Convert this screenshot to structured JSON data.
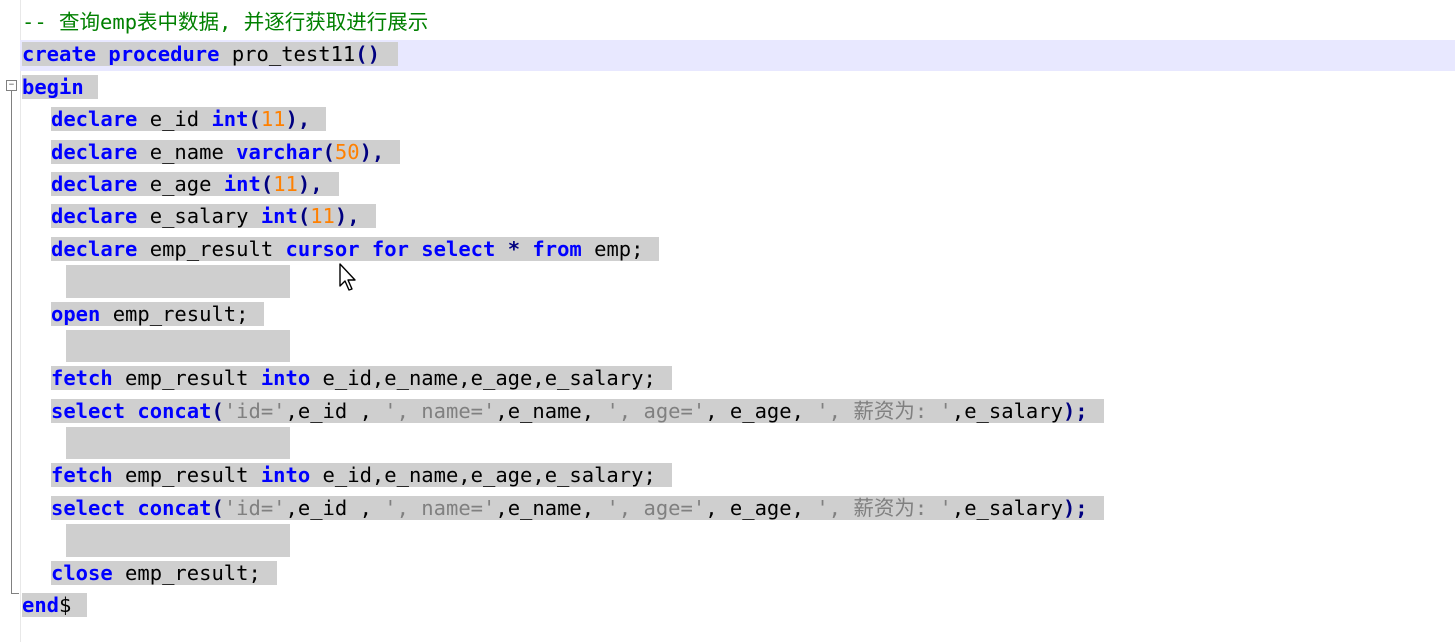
{
  "editor": {
    "comment": "-- 查询emp表中数据, 并逐行获取进行展示",
    "lines": [
      {
        "indent": 0,
        "parts": [
          [
            "kw",
            "create"
          ],
          [
            "plain",
            " "
          ],
          [
            "kw",
            "procedure"
          ],
          [
            "plain",
            " pro_test11"
          ],
          [
            "op",
            "()"
          ]
        ]
      },
      {
        "indent": 0,
        "parts": [
          [
            "kw",
            "begin"
          ]
        ]
      },
      {
        "indent": 1,
        "parts": [
          [
            "kw",
            "declare"
          ],
          [
            "plain",
            " e_id "
          ],
          [
            "kw",
            "int"
          ],
          [
            "op",
            "("
          ],
          [
            "num",
            "11"
          ],
          [
            "op",
            "),"
          ]
        ]
      },
      {
        "indent": 1,
        "parts": [
          [
            "kw",
            "declare"
          ],
          [
            "plain",
            " e_name "
          ],
          [
            "kw",
            "varchar"
          ],
          [
            "op",
            "("
          ],
          [
            "num",
            "50"
          ],
          [
            "op",
            "),"
          ]
        ]
      },
      {
        "indent": 1,
        "parts": [
          [
            "kw",
            "declare"
          ],
          [
            "plain",
            " e_age "
          ],
          [
            "kw",
            "int"
          ],
          [
            "op",
            "("
          ],
          [
            "num",
            "11"
          ],
          [
            "op",
            "),"
          ]
        ]
      },
      {
        "indent": 1,
        "parts": [
          [
            "kw",
            "declare"
          ],
          [
            "plain",
            " e_salary "
          ],
          [
            "kw",
            "int"
          ],
          [
            "op",
            "("
          ],
          [
            "num",
            "11"
          ],
          [
            "op",
            "),"
          ]
        ]
      },
      {
        "indent": 1,
        "parts": [
          [
            "kw",
            "declare"
          ],
          [
            "plain",
            " emp_result "
          ],
          [
            "kw",
            "cursor"
          ],
          [
            "plain",
            " "
          ],
          [
            "kw",
            "for"
          ],
          [
            "plain",
            " "
          ],
          [
            "kw",
            "select"
          ],
          [
            "plain",
            " "
          ],
          [
            "op",
            "*"
          ],
          [
            "plain",
            " "
          ],
          [
            "kw",
            "from"
          ],
          [
            "plain",
            " emp;"
          ]
        ]
      },
      {
        "indent": 1,
        "parts": []
      },
      {
        "indent": 1,
        "parts": [
          [
            "kw",
            "open"
          ],
          [
            "plain",
            " emp_result;"
          ]
        ]
      },
      {
        "indent": 1,
        "parts": []
      },
      {
        "indent": 1,
        "parts": [
          [
            "kw",
            "fetch"
          ],
          [
            "plain",
            " emp_result "
          ],
          [
            "kw",
            "into"
          ],
          [
            "plain",
            " e_id,e_name,e_age,e_salary;"
          ]
        ]
      },
      {
        "indent": 1,
        "parts": [
          [
            "kw",
            "select"
          ],
          [
            "plain",
            " "
          ],
          [
            "fn",
            "concat"
          ],
          [
            "op",
            "("
          ],
          [
            "str",
            "'id='"
          ],
          [
            "plain",
            ",e_id , "
          ],
          [
            "str",
            "', name='"
          ],
          [
            "plain",
            ",e_name, "
          ],
          [
            "str",
            "', age='"
          ],
          [
            "plain",
            ", e_age, "
          ],
          [
            "str",
            "', 薪资为: '"
          ],
          [
            "plain",
            ",e_salary"
          ],
          [
            "op",
            ");"
          ]
        ]
      },
      {
        "indent": 1,
        "parts": []
      },
      {
        "indent": 1,
        "parts": [
          [
            "kw",
            "fetch"
          ],
          [
            "plain",
            " emp_result "
          ],
          [
            "kw",
            "into"
          ],
          [
            "plain",
            " e_id,e_name,e_age,e_salary;"
          ]
        ]
      },
      {
        "indent": 1,
        "parts": [
          [
            "kw",
            "select"
          ],
          [
            "plain",
            " "
          ],
          [
            "fn",
            "concat"
          ],
          [
            "op",
            "("
          ],
          [
            "str",
            "'id='"
          ],
          [
            "plain",
            ",e_id , "
          ],
          [
            "str",
            "', name='"
          ],
          [
            "plain",
            ",e_name, "
          ],
          [
            "str",
            "', age='"
          ],
          [
            "plain",
            ", e_age, "
          ],
          [
            "str",
            "', 薪资为: '"
          ],
          [
            "plain",
            ",e_salary"
          ],
          [
            "op",
            ");"
          ]
        ]
      },
      {
        "indent": 1,
        "parts": []
      },
      {
        "indent": 1,
        "parts": [
          [
            "kw",
            "close"
          ],
          [
            "plain",
            " emp_result;"
          ]
        ]
      },
      {
        "indent": 0,
        "parts": [
          [
            "kw",
            "end"
          ],
          [
            "plain",
            "$"
          ]
        ]
      }
    ]
  },
  "icons": {
    "fold": "fold-collapse-icon",
    "cursor": "mouse-pointer-icon"
  },
  "colors": {
    "keyword": "#0000ff",
    "number": "#ff8000",
    "string": "#808080",
    "comment": "#008000",
    "selection": "#cfcfcf",
    "current_line": "#e8e8ff"
  }
}
